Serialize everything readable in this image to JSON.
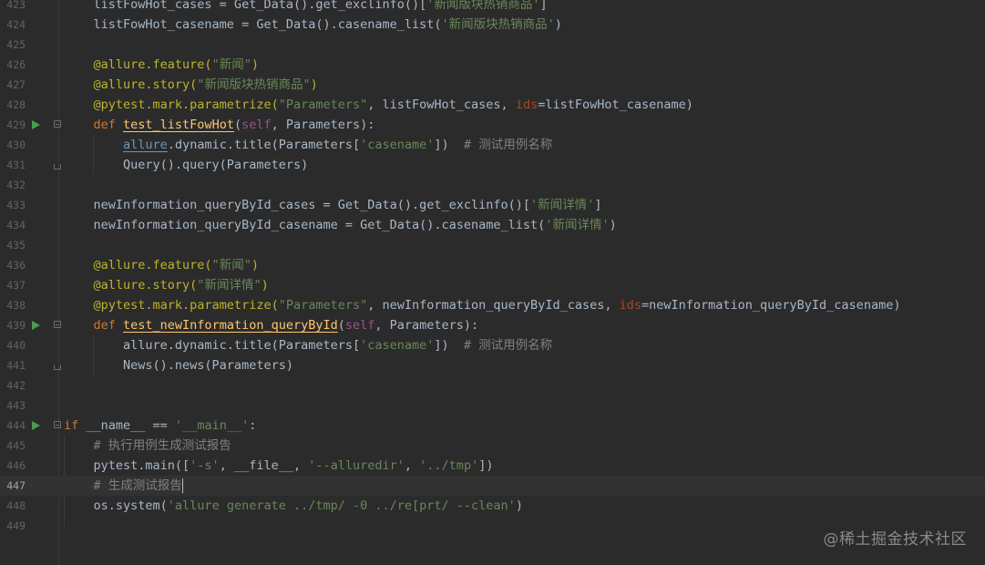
{
  "editor": {
    "current_line": "447",
    "lines": [
      {
        "no": "423",
        "run": false,
        "fold": "",
        "tokens": [
          {
            "t": "    listFowHot_cases = Get_Data().get_exclinfo()[",
            "c": ""
          },
          {
            "t": "'新闻版块热销商品'",
            "c": "str"
          },
          {
            "t": "]",
            "c": ""
          }
        ]
      },
      {
        "no": "424",
        "run": false,
        "fold": "",
        "tokens": [
          {
            "t": "    listFowHot_casename = Get_Data().casename_list(",
            "c": ""
          },
          {
            "t": "'新闻版块热销商品'",
            "c": "str"
          },
          {
            "t": ")",
            "c": ""
          }
        ]
      },
      {
        "no": "425",
        "run": false,
        "fold": "",
        "tokens": []
      },
      {
        "no": "426",
        "run": false,
        "fold": "",
        "tokens": [
          {
            "t": "    @allure.feature(",
            "c": "dec"
          },
          {
            "t": "\"新闻\"",
            "c": "str"
          },
          {
            "t": ")",
            "c": "dec"
          }
        ]
      },
      {
        "no": "427",
        "run": false,
        "fold": "",
        "tokens": [
          {
            "t": "    @allure.story(",
            "c": "dec"
          },
          {
            "t": "\"新闻版块热销商品\"",
            "c": "str"
          },
          {
            "t": ")",
            "c": "dec"
          }
        ]
      },
      {
        "no": "428",
        "run": false,
        "fold": "",
        "tokens": [
          {
            "t": "    @pytest.mark.parametrize(",
            "c": "dec"
          },
          {
            "t": "\"Parameters\"",
            "c": "str"
          },
          {
            "t": ", listFowHot_cases, ",
            "c": ""
          },
          {
            "t": "ids",
            "c": "param"
          },
          {
            "t": "=listFowHot_casename)",
            "c": ""
          }
        ]
      },
      {
        "no": "429",
        "run": true,
        "fold": "open",
        "tokens": [
          {
            "t": "    ",
            "c": ""
          },
          {
            "t": "def ",
            "c": "kw"
          },
          {
            "t": "test_listFowHot",
            "c": "fn"
          },
          {
            "t": "(",
            "c": ""
          },
          {
            "t": "self",
            "c": "self"
          },
          {
            "t": ", Parameters):",
            "c": ""
          }
        ]
      },
      {
        "no": "430",
        "run": false,
        "fold": "",
        "tokens": [
          {
            "t": "        ",
            "c": ""
          },
          {
            "t": "allure",
            "c": "ulblue"
          },
          {
            "t": ".dynamic.title(Parameters[",
            "c": ""
          },
          {
            "t": "'casename'",
            "c": "str"
          },
          {
            "t": "])  ",
            "c": ""
          },
          {
            "t": "# 测试用例名称",
            "c": "cmt"
          }
        ]
      },
      {
        "no": "431",
        "run": false,
        "fold": "end",
        "tokens": [
          {
            "t": "        Query().query(Parameters)",
            "c": ""
          }
        ]
      },
      {
        "no": "432",
        "run": false,
        "fold": "",
        "tokens": []
      },
      {
        "no": "433",
        "run": false,
        "fold": "",
        "tokens": [
          {
            "t": "    newInformation_queryById_cases = Get_Data().get_exclinfo()[",
            "c": ""
          },
          {
            "t": "'新闻详情'",
            "c": "str"
          },
          {
            "t": "]",
            "c": ""
          }
        ]
      },
      {
        "no": "434",
        "run": false,
        "fold": "",
        "tokens": [
          {
            "t": "    newInformation_queryById_casename = Get_Data().casename_list(",
            "c": ""
          },
          {
            "t": "'新闻详情'",
            "c": "str"
          },
          {
            "t": ")",
            "c": ""
          }
        ]
      },
      {
        "no": "435",
        "run": false,
        "fold": "",
        "tokens": []
      },
      {
        "no": "436",
        "run": false,
        "fold": "",
        "tokens": [
          {
            "t": "    @allure.feature(",
            "c": "dec"
          },
          {
            "t": "\"新闻\"",
            "c": "str"
          },
          {
            "t": ")",
            "c": "dec"
          }
        ]
      },
      {
        "no": "437",
        "run": false,
        "fold": "",
        "tokens": [
          {
            "t": "    @allure.story(",
            "c": "dec"
          },
          {
            "t": "\"新闻详情\"",
            "c": "str"
          },
          {
            "t": ")",
            "c": "dec"
          }
        ]
      },
      {
        "no": "438",
        "run": false,
        "fold": "",
        "tokens": [
          {
            "t": "    @pytest.mark.parametrize(",
            "c": "dec"
          },
          {
            "t": "\"Parameters\"",
            "c": "str"
          },
          {
            "t": ", newInformation_queryById_cases, ",
            "c": ""
          },
          {
            "t": "ids",
            "c": "param"
          },
          {
            "t": "=newInformation_queryById_casename)",
            "c": ""
          }
        ]
      },
      {
        "no": "439",
        "run": true,
        "fold": "open",
        "tokens": [
          {
            "t": "    ",
            "c": ""
          },
          {
            "t": "def ",
            "c": "kw"
          },
          {
            "t": "test_newInformation_queryById",
            "c": "fn"
          },
          {
            "t": "(",
            "c": ""
          },
          {
            "t": "self",
            "c": "self"
          },
          {
            "t": ", Parameters):",
            "c": ""
          }
        ]
      },
      {
        "no": "440",
        "run": false,
        "fold": "",
        "tokens": [
          {
            "t": "        allure.dynamic.title(Parameters[",
            "c": ""
          },
          {
            "t": "'casename'",
            "c": "str"
          },
          {
            "t": "])  ",
            "c": ""
          },
          {
            "t": "# 测试用例名称",
            "c": "cmt"
          }
        ]
      },
      {
        "no": "441",
        "run": false,
        "fold": "end",
        "tokens": [
          {
            "t": "        News().news(Parameters)",
            "c": ""
          }
        ]
      },
      {
        "no": "442",
        "run": false,
        "fold": "",
        "tokens": []
      },
      {
        "no": "443",
        "run": false,
        "fold": "",
        "tokens": []
      },
      {
        "no": "444",
        "run": true,
        "fold": "open",
        "tokens": [
          {
            "t": "if ",
            "c": "kw"
          },
          {
            "t": "__name__ == ",
            "c": ""
          },
          {
            "t": "'__main__'",
            "c": "str"
          },
          {
            "t": ":",
            "c": ""
          }
        ]
      },
      {
        "no": "445",
        "run": false,
        "fold": "",
        "tokens": [
          {
            "t": "    ",
            "c": ""
          },
          {
            "t": "# 执行用例生成测试报告",
            "c": "cmt"
          }
        ]
      },
      {
        "no": "446",
        "run": false,
        "fold": "",
        "tokens": [
          {
            "t": "    pytest.main([",
            "c": ""
          },
          {
            "t": "'-s'",
            "c": "str"
          },
          {
            "t": ", __file__, ",
            "c": ""
          },
          {
            "t": "'--alluredir'",
            "c": "str"
          },
          {
            "t": ", ",
            "c": ""
          },
          {
            "t": "'../tmp'",
            "c": "str"
          },
          {
            "t": "])",
            "c": ""
          }
        ]
      },
      {
        "no": "447",
        "run": false,
        "fold": "",
        "tokens": [
          {
            "t": "    ",
            "c": ""
          },
          {
            "t": "# 生成测试报告",
            "c": "cmt"
          }
        ]
      },
      {
        "no": "448",
        "run": false,
        "fold": "",
        "tokens": [
          {
            "t": "    os.system(",
            "c": ""
          },
          {
            "t": "'allure generate ../tmp/ -0 ../re[prt/ --clean'",
            "c": "str"
          },
          {
            "t": ")",
            "c": ""
          }
        ]
      },
      {
        "no": "449",
        "run": false,
        "fold": "",
        "tokens": []
      }
    ]
  },
  "watermark": "@稀土掘金技术社区"
}
